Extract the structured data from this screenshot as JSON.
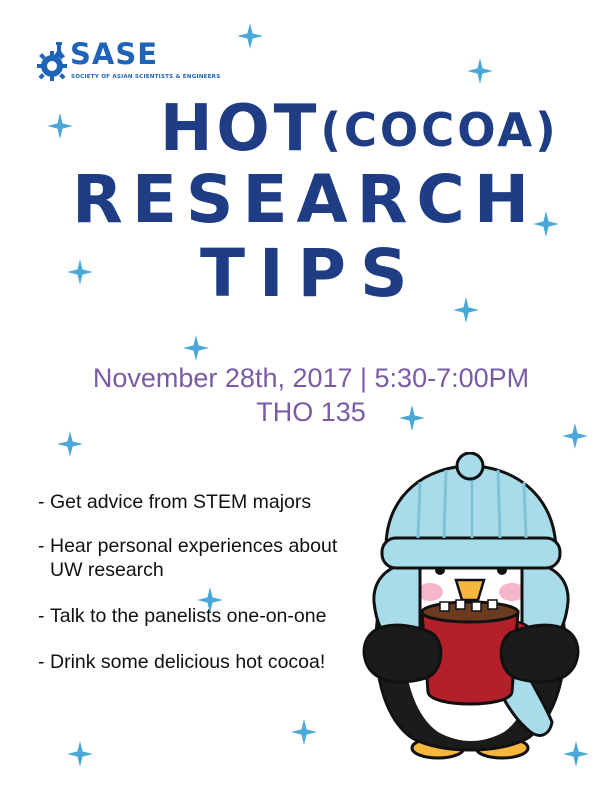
{
  "logo": {
    "name": "SASE",
    "tagline": "SOCIETY OF ASIAN SCIENTISTS & ENGINEERS"
  },
  "headline": {
    "line1_main": "HOT",
    "line1_paren": "(COCOA)",
    "line2": "RESEARCH",
    "line3": "TIPS"
  },
  "event": {
    "date_time": "November 28th, 2017 | 5:30-7:00PM",
    "location": "THO 135"
  },
  "bullets": [
    "Get advice from STEM majors",
    "Hear personal experiences about UW research",
    "Talk to the panelists one-on-one",
    "Drink some delicious hot cocoa!"
  ],
  "colors": {
    "headline": "#1e3d85",
    "event_text": "#7a5ba8",
    "logo": "#1f63b6",
    "stars": "#4aa9d9",
    "hat": "#a8dcea",
    "mug": "#b3202a"
  },
  "icons": {
    "logo_mark": "gear-flask-icon",
    "decoration": "star-icon",
    "illustration": "penguin-with-cocoa-mug"
  }
}
